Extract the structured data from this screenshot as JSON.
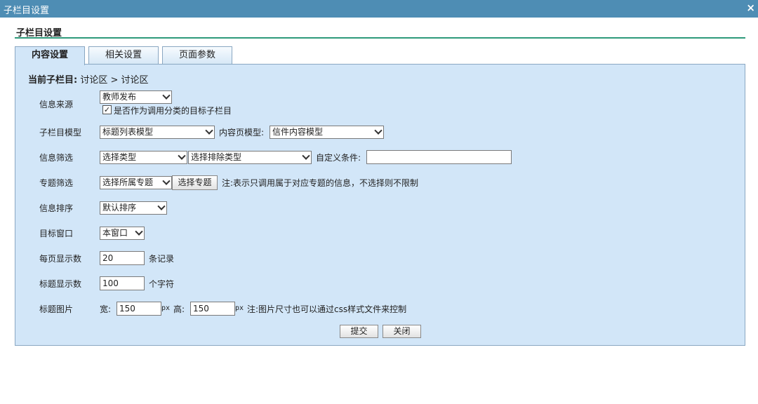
{
  "window": {
    "title": "子栏目设置",
    "close_glyph": "×"
  },
  "section": {
    "title": "子栏目设置"
  },
  "tabs": [
    "内容设置",
    "相关设置",
    "页面参数"
  ],
  "breadcrumb": {
    "label": "当前子栏目:",
    "path": "讨论区 > 讨论区"
  },
  "form": {
    "source": {
      "label": "信息来源",
      "value": "教师发布",
      "checkbox_checked": true,
      "checkbox_label": "是否作为调用分类的目标子栏目"
    },
    "model": {
      "label": "子栏目模型",
      "list_value": "标题列表模型",
      "content_label": "内容页模型:",
      "content_value": "信件内容模型"
    },
    "filter": {
      "label": "信息筛选",
      "type_value": "选择类型",
      "exclude_value": "选择排除类型",
      "custom_label": "自定义条件:",
      "custom_value": ""
    },
    "topic": {
      "label": "专题筛选",
      "value": "选择所属专题",
      "button": "选择专题",
      "note": "注:表示只调用属于对应专题的信息，不选择则不限制"
    },
    "sort": {
      "label": "信息排序",
      "value": "默认排序"
    },
    "target": {
      "label": "目标窗口",
      "value": "本窗口"
    },
    "per_page": {
      "label": "每页显示数",
      "value": "20",
      "suffix": "条记录"
    },
    "title_len": {
      "label": "标题显示数",
      "value": "100",
      "suffix": "个字符"
    },
    "image": {
      "label": "标题图片",
      "width_label": "宽:",
      "width_value": "150",
      "height_label": "高:",
      "height_value": "150",
      "unit": "px",
      "note": "注:图片尺寸也可以通过css样式文件来控制"
    }
  },
  "actions": {
    "submit": "提交",
    "close": "关闭"
  }
}
